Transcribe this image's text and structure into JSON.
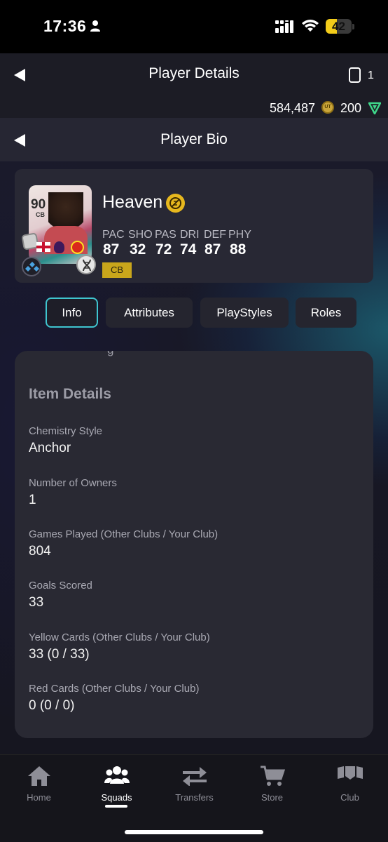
{
  "status_bar": {
    "time": "17:36",
    "battery": "42",
    "battery_level": 0.42
  },
  "header": {
    "title": "Player Details",
    "cards_count": "1",
    "coins": "584,487",
    "coin_icon_text": "UT",
    "points": "200"
  },
  "sub_header": {
    "title": "Player Bio"
  },
  "player": {
    "rating": "90",
    "position": "CB",
    "name": "Heaven",
    "stats": [
      {
        "label": "PAC",
        "value": "87"
      },
      {
        "label": "SHO",
        "value": "32"
      },
      {
        "label": "PAS",
        "value": "72"
      },
      {
        "label": "DRI",
        "value": "74"
      },
      {
        "label": "DEF",
        "value": "87"
      },
      {
        "label": "PHY",
        "value": "88"
      }
    ],
    "position_tag": "CB"
  },
  "tabs": [
    "Info",
    "Attributes",
    "PlayStyles",
    "Roles"
  ],
  "active_tab": "Info",
  "details": {
    "cutoff_text": "g",
    "section_title": "Item Details",
    "items": [
      {
        "label": "Chemistry Style",
        "value": "Anchor"
      },
      {
        "label": "Number of Owners",
        "value": "1"
      },
      {
        "label": "Games Played (Other Clubs / Your Club)",
        "value": "804"
      },
      {
        "label": "Goals Scored",
        "value": "33"
      },
      {
        "label": "Yellow Cards (Other Clubs / Your Club)",
        "value": "33 (0 / 33)"
      },
      {
        "label": "Red Cards (Other Clubs / Your Club)",
        "value": "0 (0 / 0)"
      }
    ]
  },
  "bottom_nav": [
    {
      "label": "Home",
      "icon": "home-icon"
    },
    {
      "label": "Squads",
      "icon": "squads-icon",
      "active": true
    },
    {
      "label": "Transfers",
      "icon": "transfers-icon"
    },
    {
      "label": "Store",
      "icon": "store-icon"
    },
    {
      "label": "Club",
      "icon": "club-icon"
    }
  ],
  "colors": {
    "accent": "#3fc5cf",
    "position_tag": "#c9a61b",
    "battery": "#f3cc1a"
  }
}
